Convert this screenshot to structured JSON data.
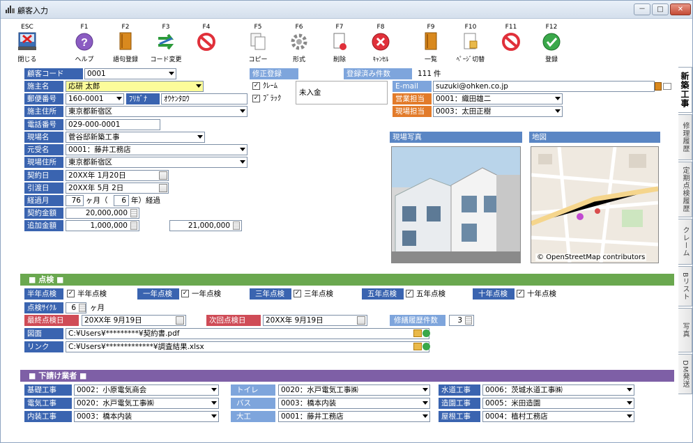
{
  "window": {
    "title": "顧客入力",
    "min": "－",
    "max": "□",
    "close": "✕"
  },
  "toolbar": [
    {
      "key": "ESC",
      "label": "閉じる",
      "icon": "close-door-icon"
    },
    {
      "key": "F1",
      "label": "ヘルプ",
      "icon": "help-icon"
    },
    {
      "key": "F2",
      "label": "語句登録",
      "icon": "book-icon"
    },
    {
      "key": "F3",
      "label": "コード変更",
      "icon": "swap-icon"
    },
    {
      "key": "F4",
      "label": "",
      "icon": "prohibit-icon"
    },
    {
      "key": "F5",
      "label": "コピー",
      "icon": "copy-icon"
    },
    {
      "key": "F6",
      "label": "形式",
      "icon": "gear-icon"
    },
    {
      "key": "F7",
      "label": "削除",
      "icon": "delete-doc-icon"
    },
    {
      "key": "F8",
      "label": "ｷｬﾝｾﾙ",
      "icon": "cancel-icon"
    },
    {
      "key": "F9",
      "label": "一覧",
      "icon": "book-icon"
    },
    {
      "key": "F10",
      "label": "ﾍﾟｰｼﾞ切替",
      "icon": "page-switch-icon"
    },
    {
      "key": "F11",
      "label": "",
      "icon": "prohibit-icon"
    },
    {
      "key": "F12",
      "label": "登録",
      "icon": "check-icon"
    }
  ],
  "form": {
    "customer_code_label": "顧客コード",
    "customer_code": "0001",
    "modify_label": "修正登録",
    "registered_count_label": "登録済み件数",
    "registered_count": "111",
    "registered_unit": "件",
    "owner_name_label": "施主名",
    "owner_name": "応研 太郎",
    "claim_label": "ｸﾚｰﾑ",
    "black_label": "ﾌﾞﾗｯｸ",
    "unpaid_label": "未入金",
    "email_label": "E-mail",
    "email": "suzuki@ohken.co.jp",
    "zip_label": "郵便番号",
    "zip": "160-0001",
    "furigana_label": "ﾌﾘｶﾞﾅ",
    "furigana": "ｵｳｹﾝﾀﾛｳ",
    "sales_label": "営業担当",
    "sales": "0001：織田雄二",
    "address_label": "施主住所",
    "address": "東京都新宿区",
    "site_mgr_label": "現場担当",
    "site_mgr": "0003：太田正樹",
    "phone_label": "電話番号",
    "phone": "029-000-0001",
    "site_name_label": "現場名",
    "site_name": "菅谷邸新築工事",
    "photo_label": "現場写真",
    "map_label": "地図",
    "map_credit": "© OpenStreetMap contributors",
    "contractor_label": "元受名",
    "contractor": "0001：藤井工務店",
    "site_addr_label": "現場住所",
    "site_addr": "東京都新宿区",
    "contract_date_label": "契約日",
    "contract_date": "20XX年 1月20日",
    "delivery_date_label": "引渡日",
    "delivery_date": "20XX年 5月 2日",
    "elapsed_label": "経過月",
    "elapsed_months": "76",
    "elapsed_unit1": "ヶ月（",
    "elapsed_years": "6",
    "elapsed_unit2": "年）経過",
    "amount_label": "契約金額",
    "amount": "20,000,000",
    "extra_label": "追加金額",
    "extra": "1,000,000",
    "total": "21,000,000"
  },
  "inspection": {
    "title": "■ 点検 ■",
    "half": "半年点検",
    "one": "一年点検",
    "three": "三年点検",
    "five": "五年点検",
    "ten": "十年点検",
    "cycle_label": "点検ｻｲｸﾙ",
    "cycle": "6",
    "cycle_unit": "ヶ月",
    "last_label": "最終点検日",
    "last": "20XX年 9月19日",
    "next_label": "次回点検日",
    "next": "20XX年 9月19日",
    "repair_label": "修繕履歴件数",
    "repair": "3",
    "drawing_label": "図面",
    "drawing": "C:¥Users¥*********¥契約書.pdf",
    "link_label": "リンク",
    "link": "C:¥Users¥*************¥調査結果.xlsx"
  },
  "subcontractors": {
    "title": "■ 下請け業者 ■",
    "rows": [
      [
        {
          "k": "基礎工事",
          "v": "0002：小原電気商会"
        },
        {
          "k": "トイレ",
          "v": "0020：水戸電気工事㈱"
        },
        {
          "k": "水道工事",
          "v": "0006：茨城水道工事㈱"
        }
      ],
      [
        {
          "k": "電気工事",
          "v": "0020：水戸電気工事㈱"
        },
        {
          "k": "バス",
          "v": "0003：橋本内装"
        },
        {
          "k": "造園工事",
          "v": "0005：米田造園"
        }
      ],
      [
        {
          "k": "内装工事",
          "v": "0003：橋本内装"
        },
        {
          "k": "大工",
          "v": "0001：藤井工務店"
        },
        {
          "k": "屋根工事",
          "v": "0004：植村工務店"
        }
      ]
    ]
  },
  "sidetabs": [
    "新築工事",
    "修理履歴",
    "定期点検履歴",
    "クレーム",
    "Bリスト",
    "写真",
    "DM発送"
  ],
  "colors": {
    "label_blue": "#3a64b0",
    "label_red": "#cf4c57",
    "label_orange": "#e27b2a",
    "section_green": "#6aa84f",
    "section_purple": "#7e5fa6"
  }
}
